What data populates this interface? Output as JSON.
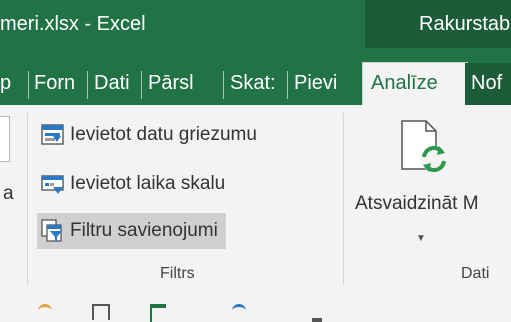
{
  "window": {
    "file_title": "meri.xlsx - Excel",
    "context_title": "Rakurstab"
  },
  "tabs": [
    {
      "label": "p"
    },
    {
      "label": "Forn"
    },
    {
      "label": "Dati"
    },
    {
      "label": "Pārsl"
    },
    {
      "label": "Skat:"
    },
    {
      "label": "Pievi"
    },
    {
      "label": "Analīze"
    },
    {
      "label": "Nof"
    }
  ],
  "ribbon": {
    "left_partial_label": "a",
    "filter_group": {
      "commands": [
        {
          "label": "Ievietot datu griezumu",
          "icon": "slicer-icon"
        },
        {
          "label": "Ievietot laika skalu",
          "icon": "timeline-icon"
        },
        {
          "label": "Filtru savienojumi",
          "icon": "filter-connections-icon"
        }
      ],
      "label": "Filtrs"
    },
    "data_group": {
      "refresh_label": "Atsvaidzināt M",
      "label": "Dati"
    }
  },
  "colors": {
    "excel_green": "#217346",
    "context_green": "#1d5c38",
    "ribbon_bg": "#f3f3f3",
    "refresh_green": "#2f9a4e",
    "icon_blue": "#2b78c5"
  }
}
